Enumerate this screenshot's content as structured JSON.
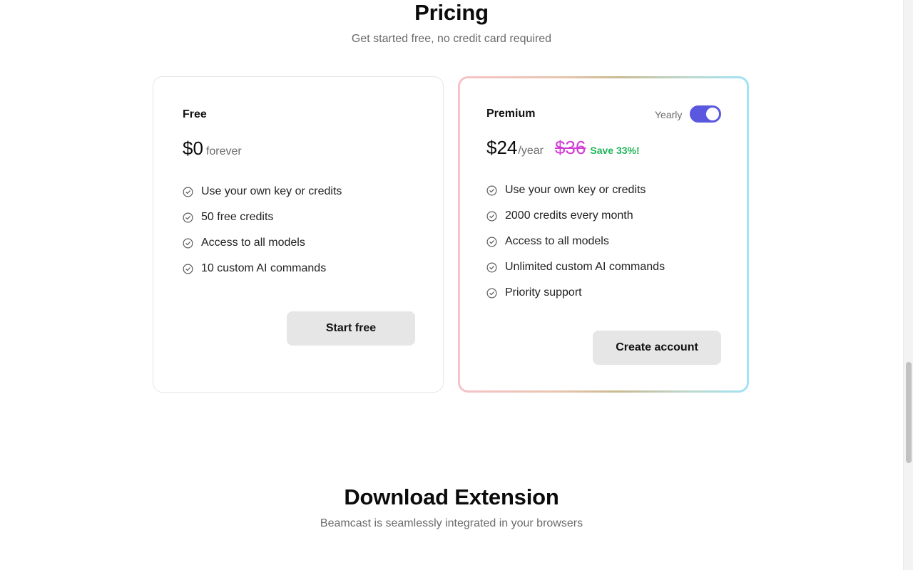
{
  "pricing": {
    "title": "Pricing",
    "subtitle": "Get started free, no credit card required",
    "free": {
      "name": "Free",
      "price": "$0",
      "unit": "forever",
      "features": [
        "Use your own key or credits",
        "50 free credits",
        "Access to all models",
        "10 custom AI commands"
      ],
      "button": "Start free"
    },
    "premium": {
      "name": "Premium",
      "toggle_label": "Yearly",
      "toggle_on": true,
      "price": "$24",
      "unit": "/year",
      "old_price": "$36",
      "save": "Save 33%!",
      "features": [
        "Use your own key or credits",
        "2000 credits every month",
        "Access to all models",
        "Unlimited custom AI commands",
        "Priority support"
      ],
      "button": "Create account"
    }
  },
  "download": {
    "title": "Download Extension",
    "subtitle": "Beamcast is seamlessly integrated in your browsers"
  },
  "icons": {
    "feature": "check-circle-icon"
  },
  "colors": {
    "accent": "#5b58e0",
    "old_price": "#d23ad6",
    "save": "#21b55a",
    "button_bg": "#e6e6e6"
  }
}
